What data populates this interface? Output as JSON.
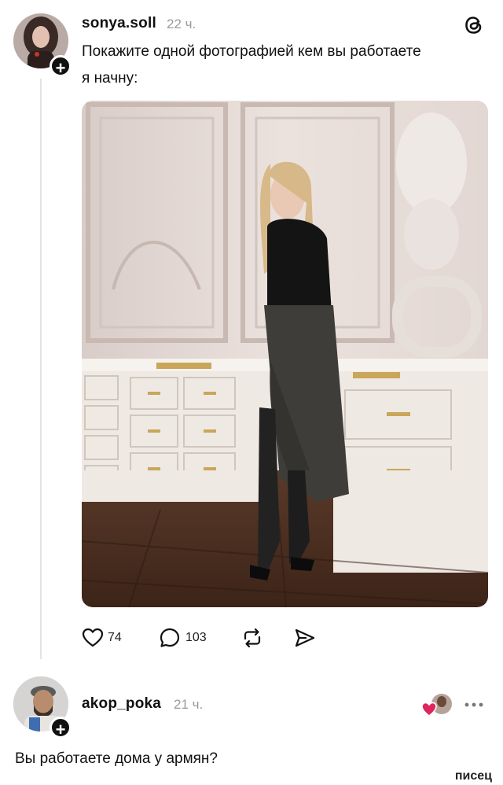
{
  "post": {
    "username": "sonya.soll",
    "time": "22 ч.",
    "text_line1": "Покажите одной фотографией кем вы работаете",
    "text_line2": "я начну:",
    "likes": "74",
    "comments": "103",
    "icons": {
      "app": "threads-logo-icon",
      "like": "heart-icon",
      "comment": "comment-bubble-icon",
      "repost": "repost-icon",
      "share": "send-icon",
      "follow": "plus-icon"
    }
  },
  "reply": {
    "username": "akop_poka",
    "time": "21 ч.",
    "text": "Вы работаете дома у армян?",
    "icons": {
      "liked_badge": "liked-heart-avatar-icon",
      "more": "more-dots-icon",
      "follow": "plus-icon"
    }
  },
  "watermark": "писец",
  "colors": {
    "like_red": "#e0245e",
    "muted": "#9a9a9a",
    "thread_line": "#e3e3e3"
  }
}
